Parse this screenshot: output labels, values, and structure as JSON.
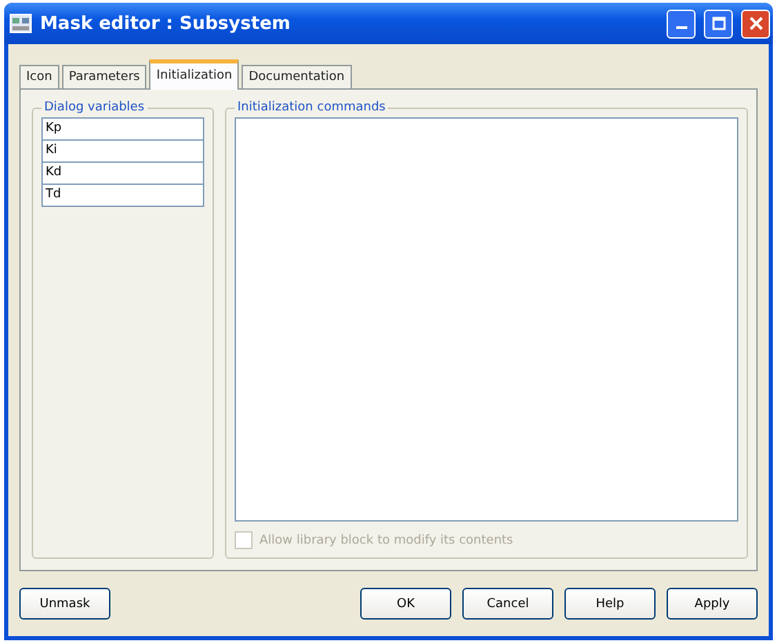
{
  "window": {
    "title": "Mask editor : Subsystem"
  },
  "tabs": [
    {
      "label": "Icon",
      "selected": false
    },
    {
      "label": "Parameters",
      "selected": false
    },
    {
      "label": "Initialization",
      "selected": true
    },
    {
      "label": "Documentation",
      "selected": false
    }
  ],
  "dialog_variables": {
    "title": "Dialog variables",
    "items": [
      "Kp",
      "Ki",
      "Kd",
      "Td"
    ]
  },
  "initialization_commands": {
    "title": "Initialization commands",
    "checkbox": {
      "label": "Allow library block to modify its contents",
      "checked": false,
      "disabled": true
    }
  },
  "buttons_left": [
    "Unmask"
  ],
  "buttons_right": [
    "OK",
    "Cancel",
    "Help",
    "Apply"
  ]
}
